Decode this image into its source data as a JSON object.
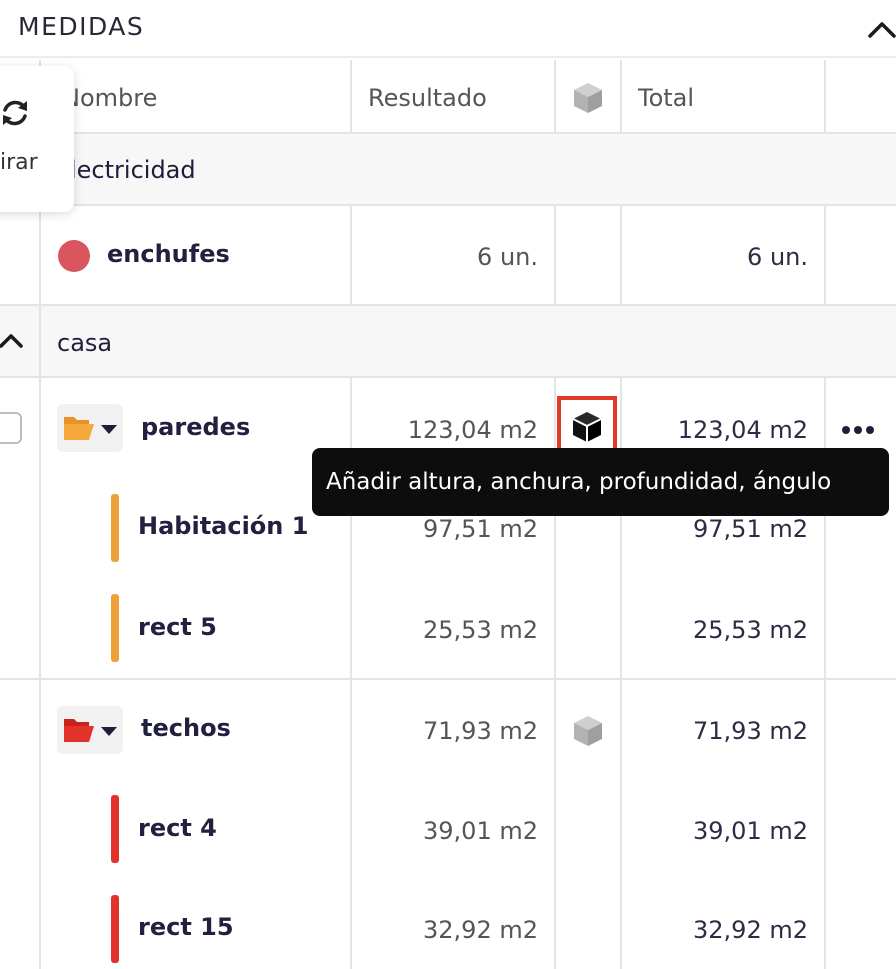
{
  "panel": {
    "title": "MEDIDAS"
  },
  "float_card": {
    "label": "irar"
  },
  "columns": {
    "name": "Nombre",
    "result": "Resultado",
    "total": "Total"
  },
  "groups": {
    "electricidad": {
      "label": "lectricidad",
      "rows": [
        {
          "name": "enchufes",
          "result": "6 un.",
          "total": "6 un.",
          "color": "#d95560"
        }
      ]
    },
    "casa": {
      "label": "casa",
      "folders": [
        {
          "name": "paredes",
          "result": "123,04 m2",
          "total": "123,04 m2",
          "color": "#f0a03a",
          "children": [
            {
              "name": "Habitación 1",
              "result": "97,51 m2",
              "total": "97,51 m2"
            },
            {
              "name": "rect 5",
              "result": "25,53 m2",
              "total": "25,53 m2"
            }
          ]
        },
        {
          "name": "techos",
          "result": "71,93 m2",
          "total": "71,93 m2",
          "color": "#e2322c",
          "children": [
            {
              "name": "rect 4",
              "result": "39,01 m2",
              "total": "39,01 m2"
            },
            {
              "name": "rect 15",
              "result": "32,92 m2",
              "total": "32,92 m2"
            }
          ]
        }
      ]
    }
  },
  "tooltip": {
    "text": "Añadir altura, anchura, profundidad, ángulo"
  },
  "icons": {
    "collapse": "chevron-up-icon",
    "rotate": "rotate-icon",
    "cube": "cube-icon",
    "folder": "folder-open-icon",
    "more": "more-horizontal-icon"
  }
}
